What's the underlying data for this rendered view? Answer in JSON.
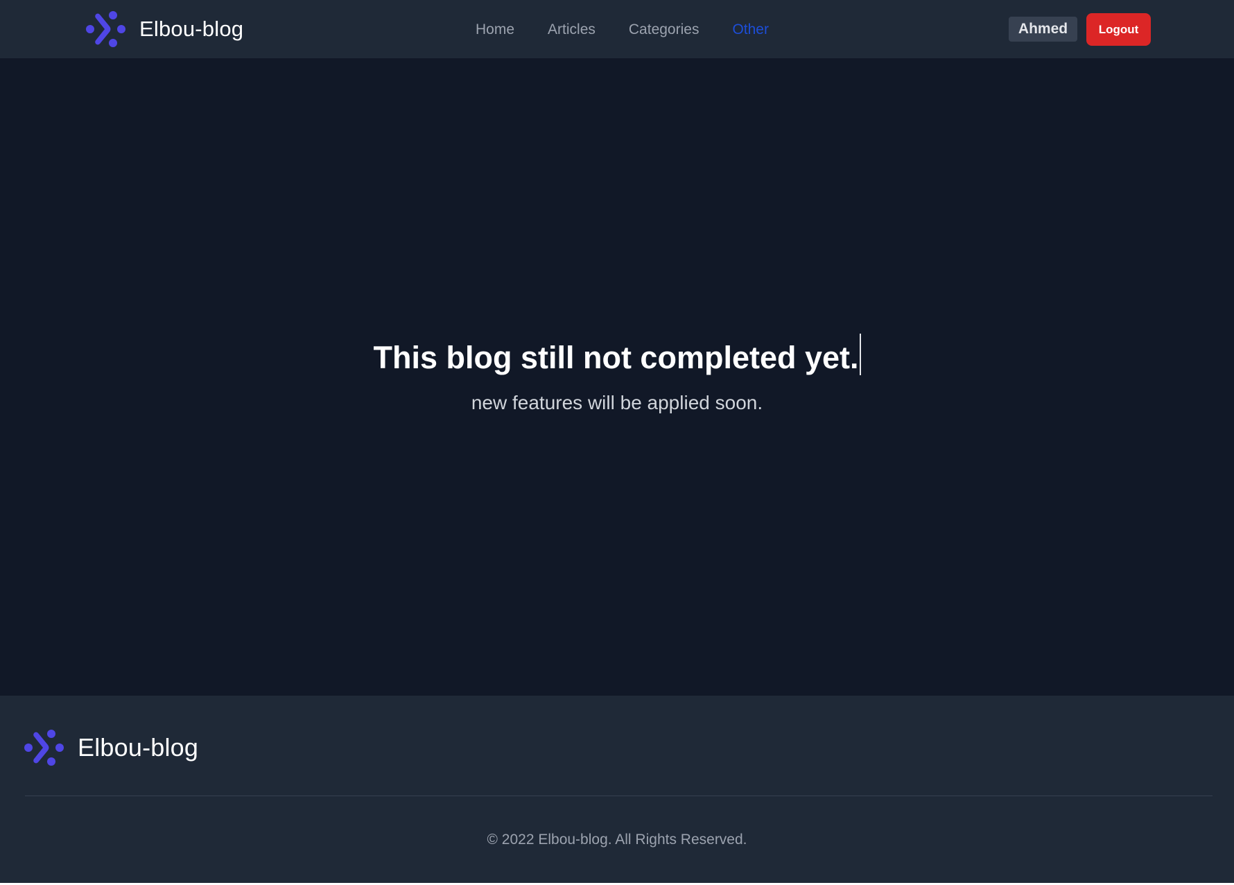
{
  "header": {
    "brand_name": "Elbou-blog",
    "nav": [
      {
        "label": "Home"
      },
      {
        "label": "Articles"
      },
      {
        "label": "Categories"
      },
      {
        "label": "Other",
        "active": true
      }
    ],
    "user_name": "Ahmed",
    "logout_label": "Logout"
  },
  "main": {
    "headline": "This blog still not completed yet.",
    "subline": "new features will be applied soon."
  },
  "footer": {
    "brand_name": "Elbou-blog",
    "copyright": "© 2022 Elbou-blog. All Rights Reserved."
  },
  "colors": {
    "header_bg": "#1f2937",
    "page_bg": "#111827",
    "brand_accent": "#4f46e5",
    "active_link": "#1d4ed8",
    "logout_bg": "#dc2626"
  },
  "icons": {
    "logo": "elbou-logo-icon"
  }
}
